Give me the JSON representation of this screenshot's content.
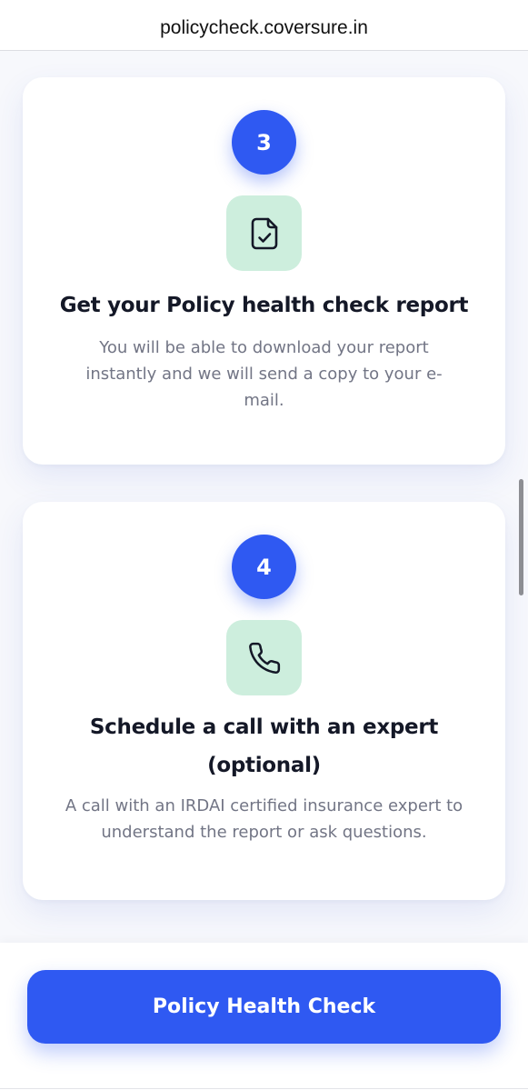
{
  "browser": {
    "url": "policycheck.coversure.in"
  },
  "steps": [
    {
      "number": "3",
      "icon": "document-check-icon",
      "title": "Get your Policy health check report",
      "description_lines": [
        "You will be able to download your report",
        "instantly and we will send a copy to your e-",
        "mail."
      ]
    },
    {
      "number": "4",
      "icon": "phone-icon",
      "title_lines": [
        "Schedule a call with an expert",
        "(optional)"
      ],
      "description_lines": [
        "A call with an IRDAI certified insurance expert to",
        "understand the report or ask questions."
      ]
    }
  ],
  "cta": {
    "label": "Policy Health Check"
  },
  "colors": {
    "primary": "#2f59f2",
    "icon_tile": "#cdeedd",
    "title": "#141827",
    "body_text": "#727585",
    "background": "#f7f8fc"
  }
}
